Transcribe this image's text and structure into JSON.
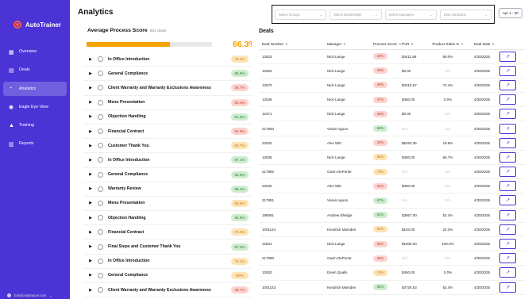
{
  "app": {
    "name": "AutoTrainer",
    "user_email": "bob@autotrainer.com"
  },
  "colors": {
    "sidebar": "#4b33d6",
    "accent": "#f4a300",
    "red": "#e84c3d",
    "green": "#4caf50"
  },
  "sidebar": {
    "items": [
      {
        "label": "Overview",
        "icon": "grid-icon"
      },
      {
        "label": "Deals",
        "icon": "deals-icon"
      },
      {
        "label": "Analytics",
        "icon": "chart-icon",
        "active": true
      },
      {
        "label": "Eagle Eye View",
        "icon": "eye-icon"
      },
      {
        "label": "Training",
        "icon": "graduation-cap-icon"
      },
      {
        "label": "Reports",
        "icon": "report-icon"
      }
    ]
  },
  "header": {
    "title": "Analytics",
    "date_range": "Apr 1 - 30"
  },
  "filters": [
    {
      "placeholder": "Select Groups"
    },
    {
      "placeholder": "Select Dealerships"
    },
    {
      "placeholder": "Select Managers"
    },
    {
      "placeholder": "Deal Attribution"
    }
  ],
  "process": {
    "title": "Average Process Score",
    "deals": "851 deals",
    "score": "66.3%",
    "score_value": 66.3,
    "rows": [
      {
        "label": "In Office Introduction",
        "score": "74.2%",
        "level": "orange"
      },
      {
        "label": "General Compliance",
        "score": "85.6%",
        "level": "green"
      },
      {
        "label": "Client Warranty and Warranty Exclusions Awareness",
        "score": "45.7%",
        "level": "red"
      },
      {
        "label": "Menu Presentation",
        "score": "50.4%",
        "level": "red"
      },
      {
        "label": "Objection Handling",
        "score": "91.8%",
        "level": "green"
      },
      {
        "label": "Financial Contract",
        "score": "52.5%",
        "level": "red"
      },
      {
        "label": "Customer Thank You",
        "score": "62.7%",
        "level": "orange"
      },
      {
        "label": "In Office Introduction",
        "score": "87.1%",
        "level": "green"
      },
      {
        "label": "General Compliance",
        "score": "84.6%",
        "level": "green"
      },
      {
        "label": "Warranty Review",
        "score": "89.4%",
        "level": "green"
      },
      {
        "label": "Menu Presentation",
        "score": "68.5%",
        "level": "orange"
      },
      {
        "label": "Objection Handling",
        "score": "94.8%",
        "level": "green"
      },
      {
        "label": "Financial Contract",
        "score": "74.2%",
        "level": "orange"
      },
      {
        "label": "Final Steps and Customer Thank You",
        "score": "87.2%",
        "level": "green"
      },
      {
        "label": "In Office Introduction",
        "score": "74.1%",
        "level": "orange"
      },
      {
        "label": "General Compliance",
        "score": "80%",
        "level": "orange"
      },
      {
        "label": "Client Warranty and Warranty Exclusions Awareness",
        "score": "46.7%",
        "level": "red"
      }
    ]
  },
  "deals": {
    "title": "Deals",
    "columns": [
      "Deal Number",
      "Manager",
      "Process Score",
      "PVR",
      "Product Sales %",
      "Deal Date"
    ],
    "rows": [
      {
        "no": "12625",
        "mgr": "Nick Lange",
        "score": "40%",
        "level": "red",
        "pvr": "$4411.69",
        "ps": "69.0%",
        "date": "4/30/2025"
      },
      {
        "no": "12602",
        "mgr": "Nick Lange",
        "score": "40%",
        "level": "red",
        "pvr": "$0.00",
        "ps": "N/A",
        "date": "4/30/2025"
      },
      {
        "no": "12570",
        "mgr": "Nick Lange",
        "score": "36%",
        "level": "red",
        "pvr": "$3315.87",
        "ps": "72.4%",
        "date": "4/30/2025"
      },
      {
        "no": "12536",
        "mgr": "Nick Lange",
        "score": "47%",
        "level": "red",
        "pvr": "$450.00",
        "ps": "0.0%",
        "date": "4/30/2025"
      },
      {
        "no": "12471",
        "mgr": "Nick Lange",
        "score": "45%",
        "level": "red",
        "pvr": "$0.00",
        "ps": "N/A",
        "date": "4/30/2025"
      },
      {
        "no": "217883",
        "mgr": "Vivian Aguon",
        "score": "96%",
        "level": "green",
        "pvr": "N/A",
        "ps": "N/A",
        "date": "4/30/2025"
      },
      {
        "no": "22032",
        "mgr": "Alex Witt",
        "score": "32%",
        "level": "red",
        "pvr": "$5020.36",
        "ps": "19.8%",
        "date": "4/30/2025"
      },
      {
        "no": "12835",
        "mgr": "Nick Lange",
        "score": "58%",
        "level": "orange",
        "pvr": "$450.00",
        "ps": "66.7%",
        "date": "4/30/2025"
      },
      {
        "no": "217882",
        "mgr": "Gavin DePonte",
        "score": "79%",
        "level": "orange",
        "pvr": "N/A",
        "ps": "N/A",
        "date": "4/30/2025"
      },
      {
        "no": "22030",
        "mgr": "Alex Witt",
        "score": "31%",
        "level": "red",
        "pvr": "$450.00",
        "ps": "N/A",
        "date": "4/30/2025"
      },
      {
        "no": "217881",
        "mgr": "Vivian Aguon",
        "score": "87%",
        "level": "green",
        "pvr": "N/A",
        "ps": "N/A",
        "date": "4/30/2025"
      },
      {
        "no": "198091",
        "mgr": "Andrew Elledge",
        "score": "81%",
        "level": "green",
        "pvr": "$3867.00",
        "ps": "52.4%",
        "date": "4/30/2025"
      },
      {
        "no": "1001144",
        "mgr": "Kendrick Marsden",
        "score": "60%",
        "level": "orange",
        "pvr": "$193.00",
        "ps": "22.3%",
        "date": "4/30/2025"
      },
      {
        "no": "12831",
        "mgr": "Nick Lange",
        "score": "55%",
        "level": "red",
        "pvr": "$1000.00",
        "ps": "100.0%",
        "date": "4/30/2025"
      },
      {
        "no": "217880",
        "mgr": "Gavin DePonte",
        "score": "45%",
        "level": "red",
        "pvr": "N/A",
        "ps": "N/A",
        "date": "4/30/2025"
      },
      {
        "no": "12820",
        "mgr": "Devin Qualls",
        "score": "74%",
        "level": "orange",
        "pvr": "$450.00",
        "ps": "0.0%",
        "date": "4/30/2025"
      },
      {
        "no": "1001143",
        "mgr": "Kendrick Marsden",
        "score": "86%",
        "level": "green",
        "pvr": "$4726.53",
        "ps": "52.4%",
        "date": "4/30/2025"
      }
    ]
  }
}
